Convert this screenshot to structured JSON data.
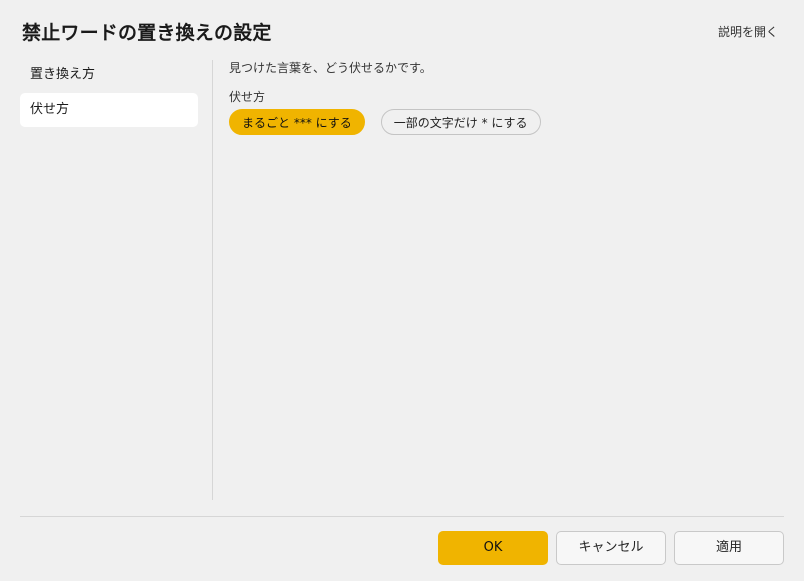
{
  "dialog": {
    "title": "禁止ワードの置き換えの設定",
    "help_link": "説明を開く"
  },
  "sidebar": {
    "items": [
      {
        "label": "置き換え方",
        "active": false
      },
      {
        "label": "伏せ方",
        "active": true
      }
    ]
  },
  "content": {
    "description": "見つけた言葉を、どう伏せるかです。",
    "group_label": "伏せ方",
    "options": [
      {
        "label": "まるごと *** にする",
        "selected": true
      },
      {
        "label": "一部の文字だけ * にする",
        "selected": false
      }
    ]
  },
  "footer": {
    "ok_label": "OK",
    "cancel_label": "キャンセル",
    "apply_label": "適用"
  },
  "colors": {
    "accent": "#f0b400",
    "background": "#f0f0f0",
    "active_item_bg": "#ffffff"
  }
}
